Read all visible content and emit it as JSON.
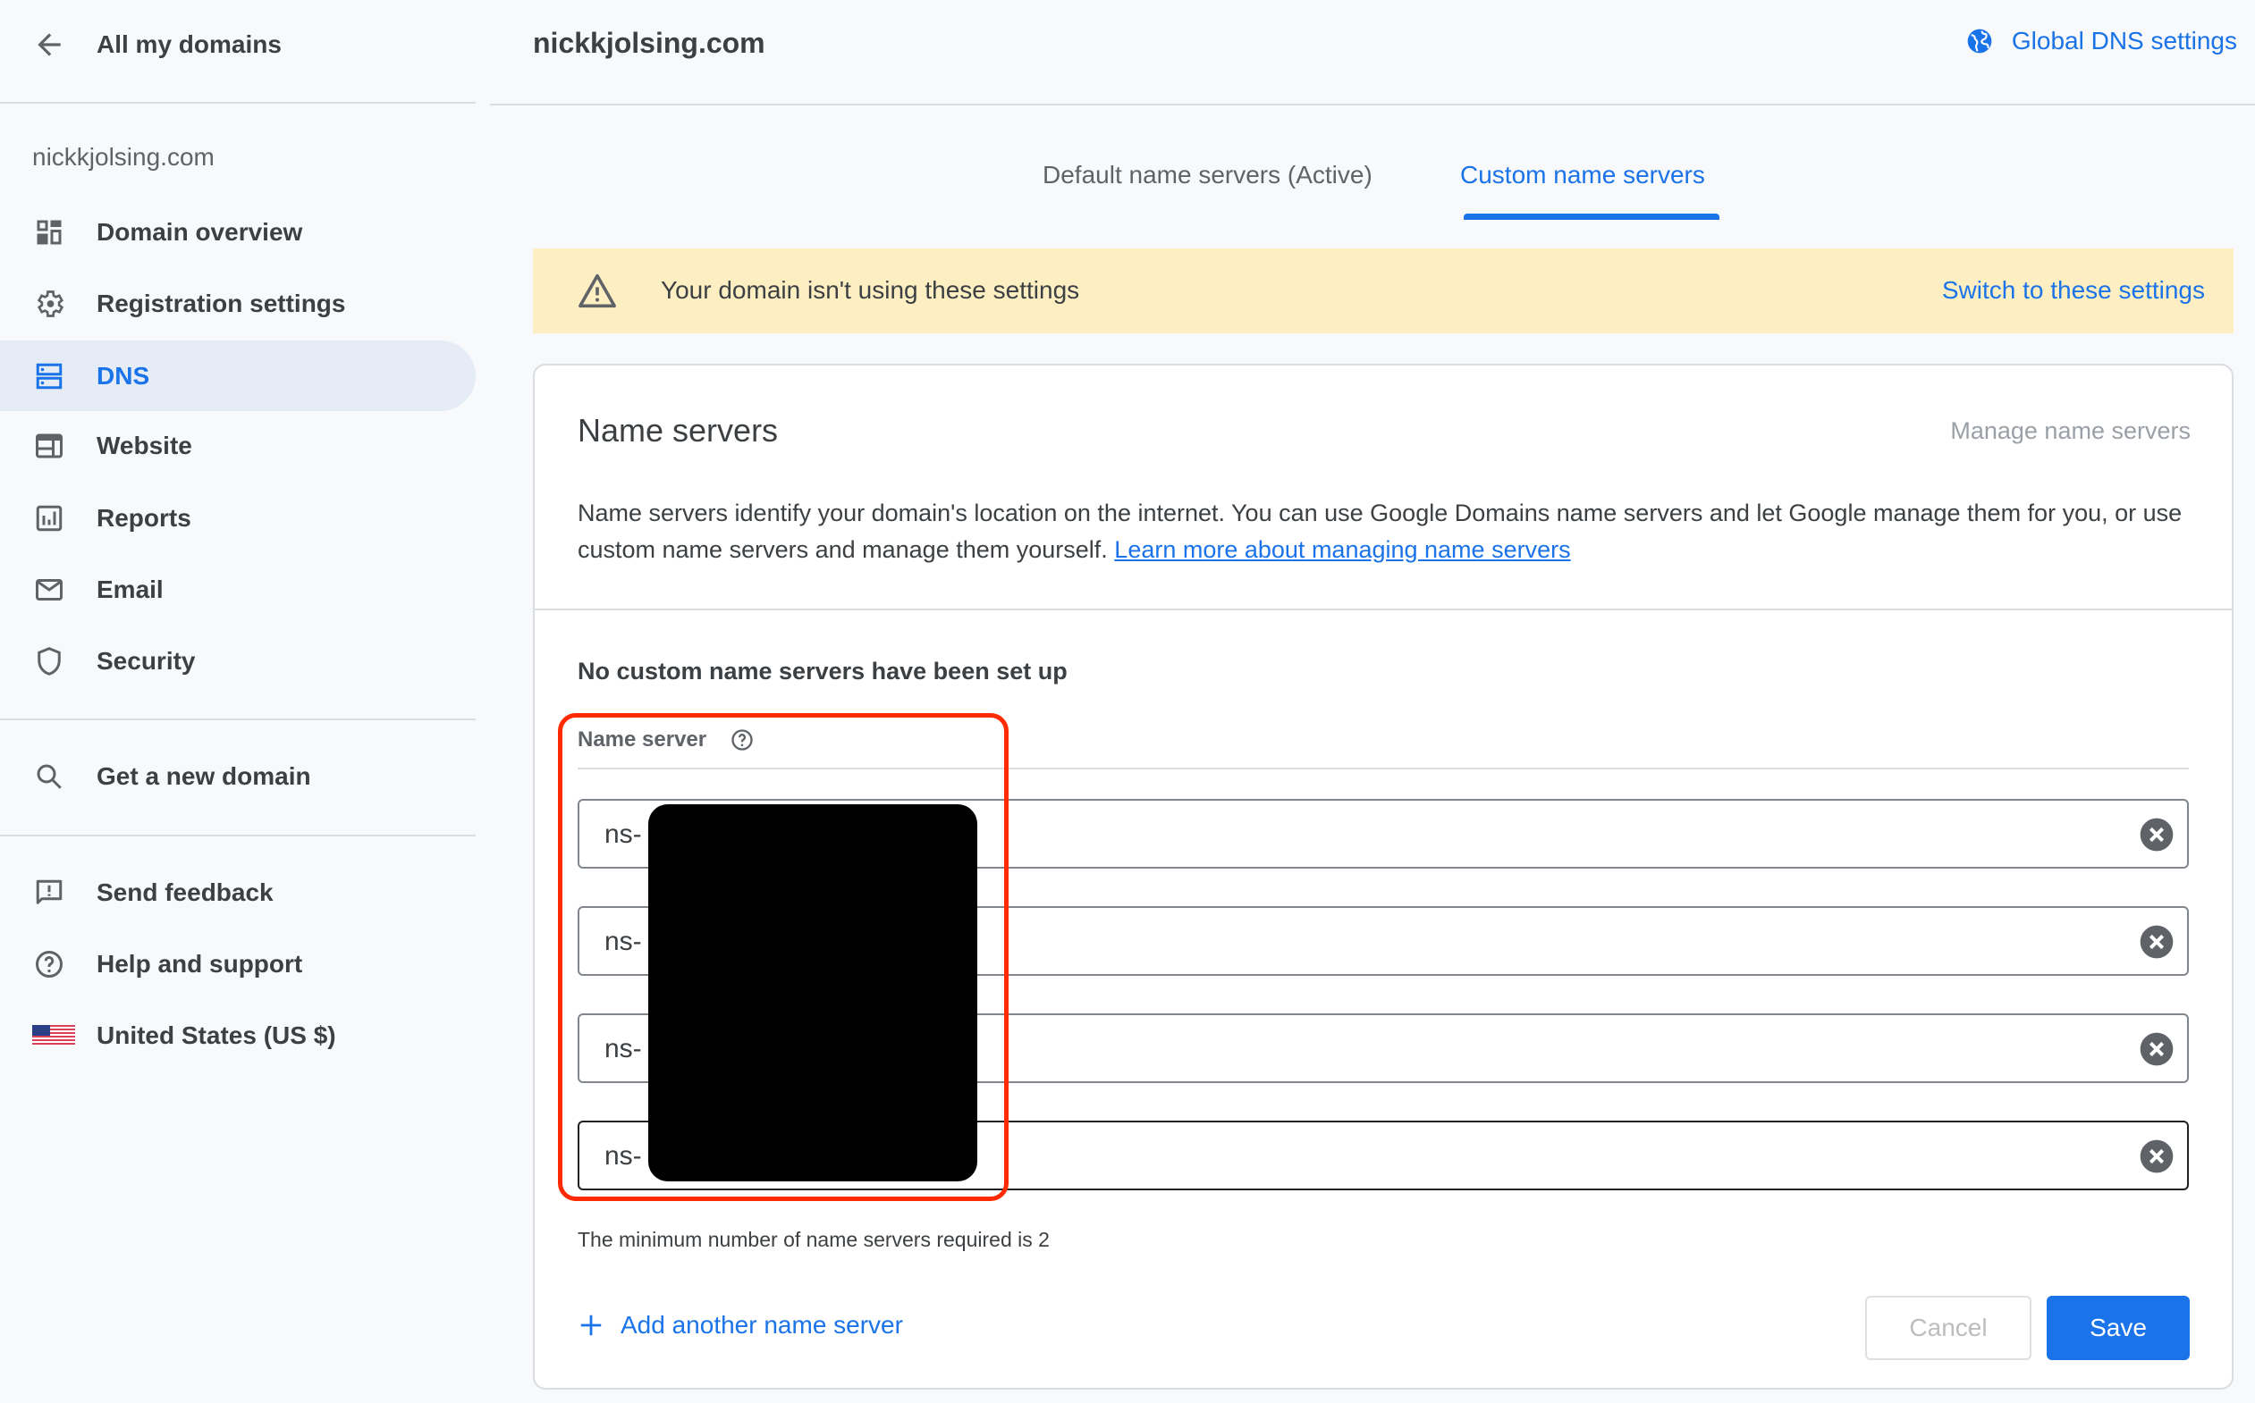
{
  "sidebar": {
    "back_label": "All my domains",
    "domain": "nickkjolsing.com",
    "nav_items": [
      {
        "label": "Domain overview",
        "icon": "dashboard-icon",
        "active": false
      },
      {
        "label": "Registration settings",
        "icon": "gear-icon",
        "active": false
      },
      {
        "label": "DNS",
        "icon": "dns-icon",
        "active": true
      },
      {
        "label": "Website",
        "icon": "website-icon",
        "active": false
      },
      {
        "label": "Reports",
        "icon": "bar-chart-icon",
        "active": false
      },
      {
        "label": "Email",
        "icon": "mail-icon",
        "active": false
      },
      {
        "label": "Security",
        "icon": "shield-icon",
        "active": false
      }
    ],
    "get_domain_label": "Get a new domain",
    "footer_items": [
      {
        "label": "Send feedback",
        "icon": "feedback-icon"
      },
      {
        "label": "Help and support",
        "icon": "help-icon"
      },
      {
        "label": "United States (US $)",
        "icon": "us-flag-icon"
      }
    ]
  },
  "header": {
    "title": "nickkjolsing.com",
    "global_dns_label": "Global DNS settings"
  },
  "tabs": [
    {
      "label": "Default name servers (Active)",
      "active": false
    },
    {
      "label": "Custom name servers",
      "active": true
    }
  ],
  "banner": {
    "message": "Your domain isn't using these settings",
    "action_label": "Switch to these settings"
  },
  "card": {
    "title": "Name servers",
    "manage_label": "Manage name servers",
    "description": "Name servers identify your domain's location on the internet. You can use Google Domains name servers and let Google manage them for you, or use custom name servers and manage them yourself.",
    "learn_more_label": "Learn more about managing name servers",
    "subheading": "No custom name servers have been set up",
    "column_label": "Name server",
    "name_servers": [
      {
        "value": "ns-"
      },
      {
        "value": "ns-"
      },
      {
        "value": "ns-"
      },
      {
        "value": "ns-"
      }
    ],
    "helper_text": "The minimum number of name servers required is 2",
    "add_label": "Add another name server",
    "cancel_label": "Cancel",
    "save_label": "Save"
  },
  "colors": {
    "accent": "#1a73e8",
    "banner_bg": "#feefc3",
    "active_nav_bg": "#e5ecf6",
    "highlight": "#ff2a00"
  }
}
